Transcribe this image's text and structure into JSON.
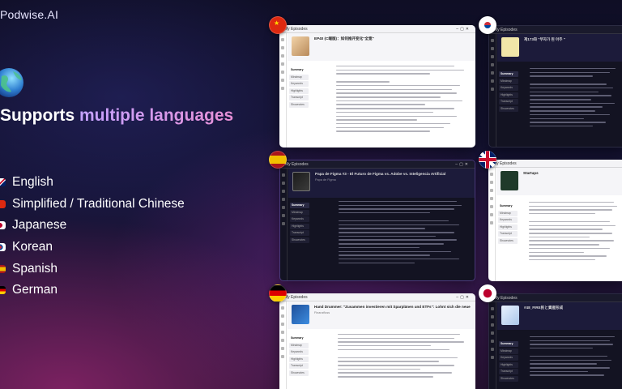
{
  "brand": {
    "name": "Podwise.AI"
  },
  "headline": {
    "lead": "Supports ",
    "accent": "multiple languages"
  },
  "languages": [
    {
      "label": "English",
      "flag": "uk"
    },
    {
      "label": "Simplified / Traditional Chinese",
      "flag": "cn"
    },
    {
      "label": "Japanese",
      "flag": "jp"
    },
    {
      "label": "Korean",
      "flag": "kr"
    },
    {
      "label": "Spanish",
      "flag": "es"
    },
    {
      "label": "German",
      "flag": "de"
    }
  ],
  "colors": {
    "accent": "#c4a2ff",
    "accent2": "#e78fd6",
    "background": "#141330"
  },
  "screens": [
    {
      "id": "cn",
      "theme": "light",
      "window_title": "My Episodes",
      "episode_title": "EP40 (C端版)：如何推开变化\"全宽\"",
      "tabs": [
        "Summary",
        "Mindmap",
        "Keywords",
        "Highlights",
        "Transcript",
        "Shownotes"
      ]
    },
    {
      "id": "kr",
      "theme": "dark",
      "window_title": "My Episodes",
      "episode_title": "제173화 \"부자가 된 아주 \"",
      "tabs": [
        "Summary",
        "Mindmap",
        "Keywords",
        "Highlights",
        "Transcript",
        "Shownotes"
      ]
    },
    {
      "id": "es",
      "theme": "dark",
      "window_title": "My Episodes",
      "episode_title": "Papa de Figma #3 - El Futuro de Figma vs. Adobe vs. Inteligencia Artificial",
      "episode_sub": "Papa de Figma",
      "tabs": [
        "Summary",
        "Mindmap",
        "Keywords",
        "Highlights",
        "Transcript",
        "Shownotes"
      ]
    },
    {
      "id": "uk",
      "theme": "light",
      "window_title": "My Episodes",
      "episode_title": "Startups",
      "tabs": [
        "Summary",
        "Mindmap",
        "Keywords",
        "Highlights",
        "Transcript",
        "Shownotes"
      ]
    },
    {
      "id": "de",
      "theme": "light",
      "window_title": "My Episodes",
      "episode_title": "Hand Drummer: \"Zusammen investieren mit Sparplänen und ETFs\": Lohnt sich die neue Auflage?",
      "episode_sub": "Finanzfluss",
      "tabs": [
        "Summary",
        "Mindmap",
        "Keywords",
        "Highlights",
        "Transcript",
        "Shownotes"
      ]
    },
    {
      "id": "jp",
      "theme": "dark",
      "window_title": "My Episodes",
      "episode_title": "#48_FIRE民と資産形成",
      "tabs": [
        "Summary",
        "Mindmap",
        "Keywords",
        "Highlights",
        "Transcript",
        "Shownotes"
      ]
    }
  ]
}
